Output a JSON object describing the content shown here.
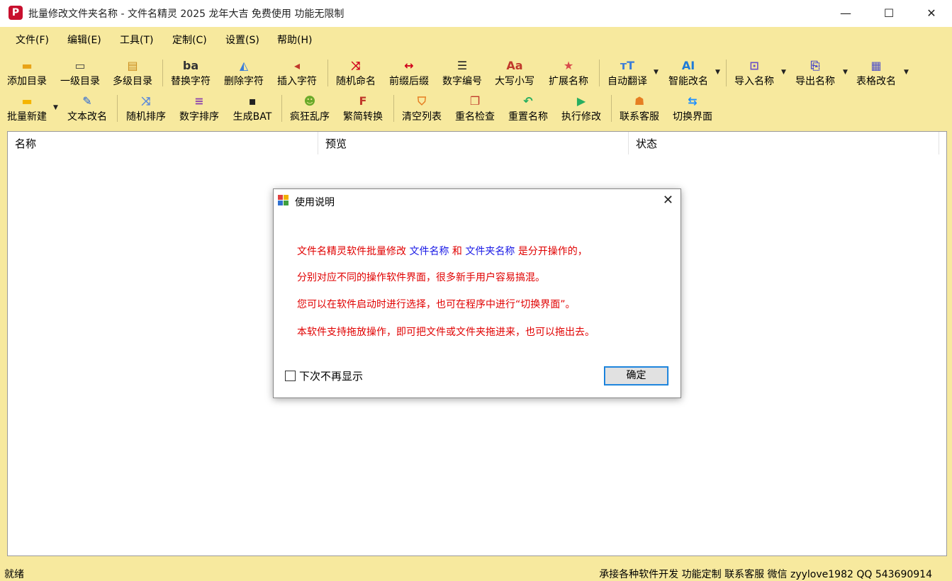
{
  "window": {
    "title": "批量修改文件夹名称 - 文件名精灵 2025 龙年大吉 免费使用 功能无限制",
    "app_icon_glyph": "P",
    "minimize_glyph": "—",
    "maximize_glyph": "☐",
    "close_glyph": "✕"
  },
  "menu": [
    "文件(F)",
    "编辑(E)",
    "工具(T)",
    "定制(C)",
    "设置(S)",
    "帮助(H)"
  ],
  "toolbar_row1": [
    {
      "label": "添加目录",
      "icon": "folder-add-icon",
      "glyph": "▬",
      "color": "#E8A317"
    },
    {
      "label": "一级目录",
      "icon": "window-icon",
      "glyph": "▭",
      "color": "#444444"
    },
    {
      "label": "多级目录",
      "icon": "stack-icon",
      "glyph": "▤",
      "color": "#C98A1A"
    },
    {
      "label": "替换字符",
      "icon": "replace-icon",
      "glyph": "ba",
      "color": "#333333"
    },
    {
      "label": "删除字符",
      "icon": "delete-char-icon",
      "glyph": "◭",
      "color": "#3B7DD8"
    },
    {
      "label": "插入字符",
      "icon": "insert-char-icon",
      "glyph": "◂",
      "color": "#C0392B"
    },
    {
      "label": "随机命名",
      "icon": "shuffle-icon",
      "glyph": "⤨",
      "color": "#D0021B"
    },
    {
      "label": "前缀后缀",
      "icon": "arrows-icon",
      "glyph": "↔",
      "color": "#D0021B"
    },
    {
      "label": "数字编号",
      "icon": "numbered-list-icon",
      "glyph": "☰",
      "color": "#222222"
    },
    {
      "label": "大写小写",
      "icon": "case-icon",
      "glyph": "Aa",
      "color": "#C0392B"
    },
    {
      "label": "扩展名称",
      "icon": "star-icon",
      "glyph": "★",
      "color": "#D84A4A"
    },
    {
      "label": "自动翻译",
      "icon": "translate-icon",
      "glyph": "тT",
      "color": "#3B7DD8"
    },
    {
      "label": "智能改名",
      "icon": "ai-icon",
      "glyph": "AI",
      "color": "#1E7BD8"
    },
    {
      "label": "导入名称",
      "icon": "import-icon",
      "glyph": "⊡",
      "color": "#6A4FC8"
    },
    {
      "label": "导出名称",
      "icon": "export-icon",
      "glyph": "⎘",
      "color": "#4A4AC8"
    },
    {
      "label": "表格改名",
      "icon": "table-icon",
      "glyph": "▦",
      "color": "#5050C8"
    }
  ],
  "toolbar_row2": [
    {
      "label": "批量新建",
      "icon": "new-folder-icon",
      "glyph": "▬",
      "color": "#F5B400"
    },
    {
      "label": "文本改名",
      "icon": "edit-icon",
      "glyph": "✎",
      "color": "#1E5FD8"
    },
    {
      "label": "随机排序",
      "icon": "random-sort-icon",
      "glyph": "⤨",
      "color": "#5B8ADB"
    },
    {
      "label": "数字排序",
      "icon": "number-sort-icon",
      "glyph": "≡",
      "color": "#8E44AD"
    },
    {
      "label": "生成BAT",
      "icon": "terminal-icon",
      "glyph": "▪",
      "color": "#222222"
    },
    {
      "label": "疯狂乱序",
      "icon": "frog-icon",
      "glyph": "☻",
      "color": "#6AAA2A"
    },
    {
      "label": "繁简转换",
      "icon": "f-letter-icon",
      "glyph": "F",
      "color": "#C0392B"
    },
    {
      "label": "清空列表",
      "icon": "broom-icon",
      "glyph": "⛉",
      "color": "#E67E22"
    },
    {
      "label": "重名检查",
      "icon": "copy-icon",
      "glyph": "❐",
      "color": "#C0392B"
    },
    {
      "label": "重置名称",
      "icon": "undo-icon",
      "glyph": "↶",
      "color": "#27AE60"
    },
    {
      "label": "执行修改",
      "icon": "play-icon",
      "glyph": "▶",
      "color": "#27AE60"
    },
    {
      "label": "联系客服",
      "icon": "support-icon",
      "glyph": "☗",
      "color": "#E67E22"
    },
    {
      "label": "切换界面",
      "icon": "switch-icon",
      "glyph": "⇆",
      "color": "#1E90FF"
    }
  ],
  "list": {
    "columns": [
      "名称",
      "预览",
      "状态"
    ]
  },
  "dialog": {
    "title": "使用说明",
    "close_glyph": "✕",
    "line1": {
      "part1": "文件名精灵软件批量修改",
      "part2": "文件名称",
      "part3": "和",
      "part4": "文件夹名称",
      "part5": "是分开操作的，"
    },
    "line2": "分别对应不同的操作软件界面，很多新手用户容易搞混。",
    "line3": "您可以在软件启动时进行选择，也可在程序中进行“切换界面”。",
    "line4": "本软件支持拖放操作，即可把文件或文件夹拖进来，也可以拖出去。",
    "checkbox_label": "下次不再显示",
    "checkbox_checked": false,
    "ok_label": "确定"
  },
  "status": {
    "left": "就绪",
    "right": "承接各种软件开发 功能定制 联系客服 微信 zyylove1982 QQ 543690914"
  },
  "colors": {
    "background": "#F7E99E",
    "dialog_red": "#E00000",
    "dialog_blue": "#1A1AE6",
    "app_icon": "#C8102E"
  }
}
